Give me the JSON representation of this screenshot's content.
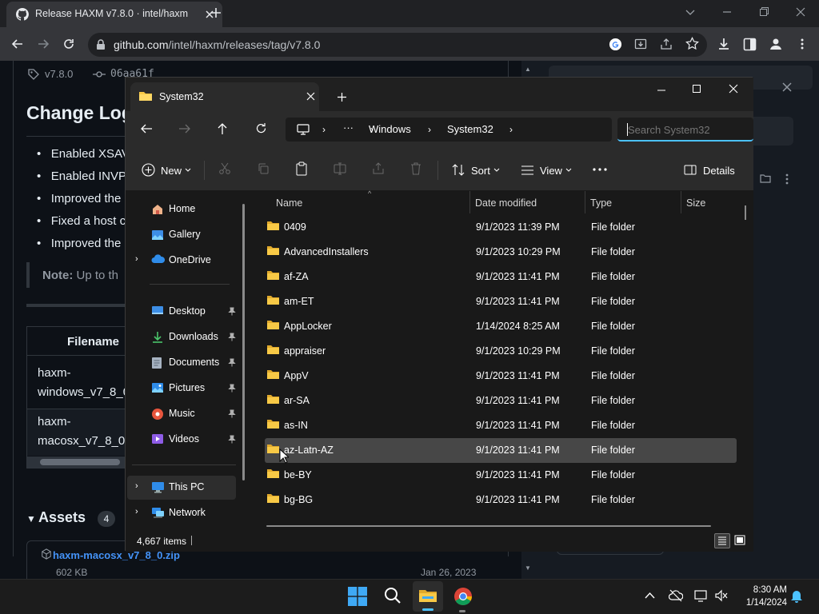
{
  "browser": {
    "tab_title": "Release HAXM v7.8.0 · intel/haxm",
    "url_domain": "github.com",
    "url_path": "/intel/haxm/releases/tag/v7.8.0"
  },
  "github": {
    "tag": "v7.8.0",
    "commit": "06aa61f",
    "heading": "Change Log",
    "bullets": [
      "Enabled XSAV",
      "Enabled INVP",
      "Improved the",
      "Fixed a host c",
      "Improved the"
    ],
    "note_label": "Note:",
    "note_text": "Up to th",
    "table_header": "Filename",
    "table_rows": [
      {
        "line1": "haxm-",
        "line2": "windows_v7_8_0"
      },
      {
        "line1": "haxm-",
        "line2": "macosx_v7_8_0."
      }
    ],
    "assets_label": "Assets",
    "assets_count": "4",
    "asset_name": "haxm-macosx_v7_8_0.zip",
    "asset_size": "602 KB",
    "asset_date": "Jan 26, 2023"
  },
  "explorer": {
    "tab_title": "System32",
    "breadcrumb": [
      "Windows",
      "System32"
    ],
    "search_placeholder": "Search System32",
    "cmd": {
      "new": "New",
      "sort": "Sort",
      "view": "View",
      "details": "Details"
    },
    "nav": [
      {
        "label": "Home",
        "icon": "home-icon"
      },
      {
        "label": "Gallery",
        "icon": "gallery-icon"
      },
      {
        "label": "OneDrive",
        "icon": "cloud-icon"
      },
      {
        "label": "Desktop",
        "icon": "desktop-icon"
      },
      {
        "label": "Downloads",
        "icon": "download-icon"
      },
      {
        "label": "Documents",
        "icon": "document-icon"
      },
      {
        "label": "Pictures",
        "icon": "pictures-icon"
      },
      {
        "label": "Music",
        "icon": "music-icon"
      },
      {
        "label": "Videos",
        "icon": "video-icon"
      },
      {
        "label": "This PC",
        "icon": "computer-icon"
      },
      {
        "label": "Network",
        "icon": "network-icon"
      }
    ],
    "columns": {
      "name": "Name",
      "date": "Date modified",
      "type": "Type",
      "size": "Size"
    },
    "files": [
      {
        "name": "0409",
        "date": "9/1/2023 11:39 PM",
        "type": "File folder"
      },
      {
        "name": "AdvancedInstallers",
        "date": "9/1/2023 10:29 PM",
        "type": "File folder"
      },
      {
        "name": "af-ZA",
        "date": "9/1/2023 11:41 PM",
        "type": "File folder"
      },
      {
        "name": "am-ET",
        "date": "9/1/2023 11:41 PM",
        "type": "File folder"
      },
      {
        "name": "AppLocker",
        "date": "1/14/2024 8:25 AM",
        "type": "File folder"
      },
      {
        "name": "appraiser",
        "date": "9/1/2023 10:29 PM",
        "type": "File folder"
      },
      {
        "name": "AppV",
        "date": "9/1/2023 11:41 PM",
        "type": "File folder"
      },
      {
        "name": "ar-SA",
        "date": "9/1/2023 11:41 PM",
        "type": "File folder"
      },
      {
        "name": "as-IN",
        "date": "9/1/2023 11:41 PM",
        "type": "File folder"
      },
      {
        "name": "az-Latn-AZ",
        "date": "9/1/2023 11:41 PM",
        "type": "File folder"
      },
      {
        "name": "be-BY",
        "date": "9/1/2023 11:41 PM",
        "type": "File folder"
      },
      {
        "name": "bg-BG",
        "date": "9/1/2023 11:41 PM",
        "type": "File folder"
      }
    ],
    "selected_index": 9,
    "status": "4,667 items"
  },
  "taskbar": {
    "time": "8:30 AM",
    "date": "1/14/2024"
  },
  "colors": {
    "accent": "#4cc2ff",
    "folder": "#f8c946",
    "link": "#4493f8"
  }
}
